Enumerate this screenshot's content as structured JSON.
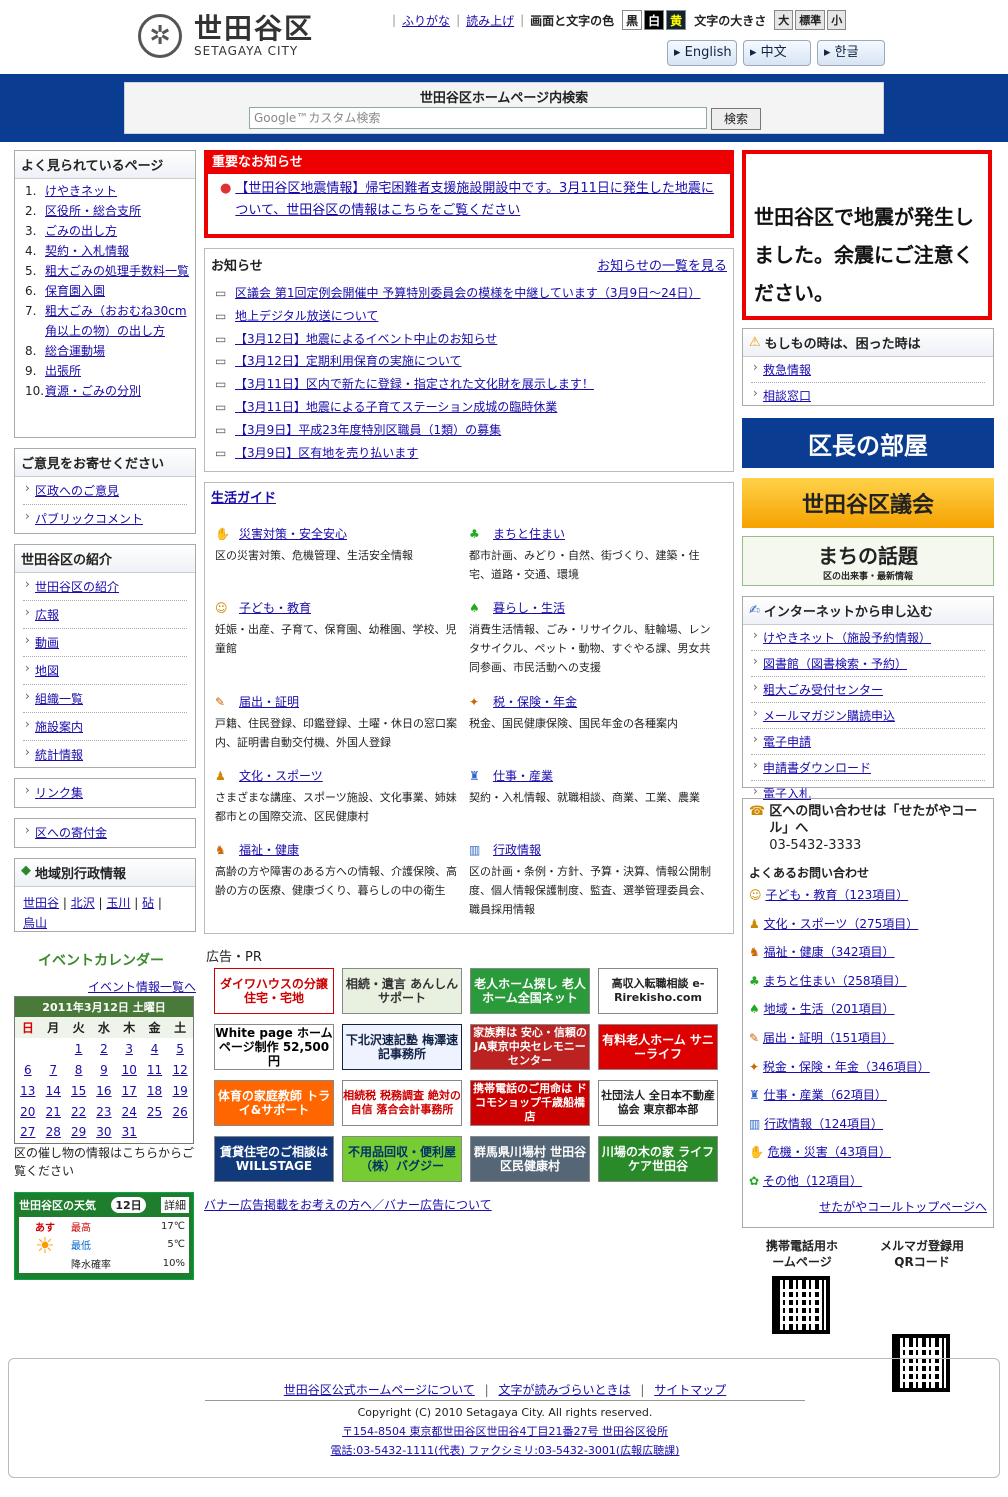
{
  "header": {
    "logo_jp": "世田谷区",
    "logo_en": "SETAGAYA CITY",
    "furigana": "ふりがな",
    "read_aloud": "読み上げ",
    "color_label": "画面と文字の色",
    "colors": [
      "黒",
      "白",
      "黄"
    ],
    "size_label": "文字の大きさ",
    "sizes": [
      "大",
      "標準",
      "小"
    ],
    "langs": [
      "▸ English",
      "▸ 中文",
      "▸ 한글"
    ]
  },
  "search": {
    "title": "世田谷区ホームページ内検索",
    "placeholder": "Google™カスタム検索",
    "button": "検索"
  },
  "popular": {
    "title": "よく見られているページ",
    "items": [
      {
        "n": "1.",
        "t": "けやきネット"
      },
      {
        "n": "2.",
        "t": "区役所・総合支所"
      },
      {
        "n": "3.",
        "t": "ごみの出し方"
      },
      {
        "n": "4.",
        "t": "契約・入札情報"
      },
      {
        "n": "5.",
        "t": "粗大ごみの処理手数料一覧"
      },
      {
        "n": "6.",
        "t": "保育園入園"
      },
      {
        "n": "7.",
        "t": "粗大ごみ（おおむね30cm角以上の物）の出し方"
      },
      {
        "n": "8.",
        "t": "総合運動場"
      },
      {
        "n": "9.",
        "t": "出張所"
      },
      {
        "n": "10.",
        "t": "資源・ごみの分別"
      }
    ]
  },
  "opinion": {
    "title": "ご意見をお寄せください",
    "items": [
      "区政へのご意見",
      "パブリックコメント"
    ]
  },
  "intro": {
    "title": "世田谷区の紹介",
    "items": [
      "世田谷区の紹介",
      "広報",
      "動画",
      "地図",
      "組織一覧",
      "施設案内",
      "統計情報"
    ]
  },
  "links": {
    "a": "リンク集",
    "b": "区への寄付金"
  },
  "regional": {
    "title": "地域別行政情報",
    "items": [
      "世田谷",
      "北沢",
      "玉川",
      "砧",
      "烏山"
    ]
  },
  "event": {
    "title": "イベントカレンダー",
    "list_link": "イベント情報一覧へ",
    "month": "2011年3月12日 土曜日",
    "dows": [
      "日",
      "月",
      "火",
      "水",
      "木",
      "金",
      "土"
    ],
    "weeks": [
      [
        "",
        "",
        "1",
        "2",
        "3",
        "4",
        "5"
      ],
      [
        "6",
        "7",
        "8",
        "9",
        "10",
        "11",
        "12"
      ],
      [
        "13",
        "14",
        "15",
        "16",
        "17",
        "18",
        "19"
      ],
      [
        "20",
        "21",
        "22",
        "23",
        "24",
        "25",
        "26"
      ],
      [
        "27",
        "28",
        "29",
        "30",
        "31",
        "",
        ""
      ]
    ],
    "note": "区の催し物の情報はこちらからご覧ください"
  },
  "weather": {
    "title": "世田谷区の天気",
    "date": "12日",
    "detail": "詳細",
    "day": "あす",
    "rows": [
      [
        "最高",
        "17℃"
      ],
      [
        "最低",
        "5℃"
      ],
      [
        "降水確率",
        "10%"
      ]
    ]
  },
  "alert": {
    "title": "重要なお知らせ",
    "text": "【世田谷区地震情報】帰宅困難者支援施設開設中です。3月11日に発生した地震について、世田谷区の情報はこちらをご覧ください"
  },
  "news": {
    "title": "お知らせ",
    "list_link": "お知らせの一覧を見る",
    "items": [
      "区議会 第1回定例会開催中 予算特別委員会の模様を中継しています（3月9日～24日）",
      "地上デジタル放送について",
      "【3月12日】地震によるイベント中止のお知らせ",
      "【3月12日】定期利用保育の実施について",
      "【3月11日】区内で新たに登録・指定された文化財を展示します！",
      "【3月11日】地震による子育てステーション成城の臨時休業",
      "【3月9日】平成23年度特別区職員（1類）の募集",
      "【3月9日】区有地を売り払います"
    ]
  },
  "guide": {
    "title": "生活ガイド",
    "items": [
      {
        "t": "災害対策・安全安心",
        "d": "区の災害対策、危機管理、生活安全情報"
      },
      {
        "t": "まちと住まい",
        "d": "都市計画、みどり・自然、街づくり、建築・住宅、道路・交通、環境"
      },
      {
        "t": "子ども・教育",
        "d": "妊娠・出産、子育て、保育園、幼稚園、学校、児童館"
      },
      {
        "t": "暮らし・生活",
        "d": "消費生活情報、ごみ・リサイクル、駐輪場、レンタサイクル、ペット・動物、すぐやる課、男女共同参画、市民活動への支援"
      },
      {
        "t": "届出・証明",
        "d": "戸籍、住民登録、印鑑登録、土曜・休日の窓口案内、証明書自動交付機、外国人登録"
      },
      {
        "t": "税・保険・年金",
        "d": "税金、国民健康保険、国民年金の各種案内"
      },
      {
        "t": "文化・スポーツ",
        "d": "さまざまな講座、スポーツ施設、文化事業、姉妹都市との国際交流、区民健康村"
      },
      {
        "t": "仕事・産業",
        "d": "契約・入札情報、就職相談、商業、工業、農業"
      },
      {
        "t": "福祉・健康",
        "d": "高齢の方や障害のある方への情報、介護保険、高齢の方の医療、健康づくり、暮らしの中の衛生"
      },
      {
        "t": "行政情報",
        "d": "区の計画・条例・方針、予算・決算、情報公開制度、個人情報保護制度、監査、選挙管理委員会、職員採用情報"
      }
    ]
  },
  "ads": {
    "title": "広告・PR",
    "items": [
      "ダイワハウスの分譲住宅・宅地",
      "相続・遺言 あんしんサポート",
      "老人ホーム探し 老人ホーム全国ネット",
      "高収入転職相談 e-Rirekisho.com",
      "White page ホームページ制作 52,500円",
      "下北沢速記塾 梅澤速記事務所",
      "家族葬は 安心・信頼の JA東京中央セレモニーセンター",
      "有料老人ホーム サニーライフ",
      "体育の家庭教師 トライ&サポート",
      "相続税 税務調査 絶対の自信 落合会計事務所",
      "携帯電話のご用命は ドコモショップ千歳船橋店",
      "社団法人 全日本不動産協会 東京都本部",
      "賃貸住宅のご相談は WILLSTAGE",
      "不用品回収・便利屋（株）バグジー",
      "群馬県川場村 世田谷区民健康村",
      "川場の木の家 ライフケア世田谷"
    ],
    "footer": "バナー広告掲載をお考えの方へ／バナー広告について"
  },
  "right": {
    "quake": "世田谷区で地震が発生しました。余震にご注意ください。",
    "emergency_title": "もしもの時は、困った時は",
    "emergency": [
      "救急情報",
      "相談窓口"
    ],
    "mayor": "区長の部屋",
    "assembly": "世田谷区議会",
    "topics": "まちの話題",
    "topics_sub": "区の出来事・最新情報",
    "online_title": "インターネットから申し込む",
    "online": [
      "けやきネット（施設予約情報）",
      "図書館（図書検索・予約）",
      "粗大ごみ受付センター",
      "メールマガジン購読申込",
      "電子申請",
      "申請書ダウンロード",
      "電子入札"
    ],
    "call_title": "区への問い合わせは「せたがやコール」へ",
    "call_tel": "03-5432-3333",
    "faq_title": "よくあるお問い合わせ",
    "faq": [
      "子ども・教育（123項目）",
      "文化・スポーツ（275項目）",
      "福祉・健康（342項目）",
      "まちと住まい（258項目）",
      "地域・生活（201項目）",
      "届出・証明（151項目）",
      "税金・保険・年金（346項目）",
      "仕事・産業（62項目）",
      "行政情報（124項目）",
      "危機・災害（43項目）",
      "その他（12項目）"
    ],
    "call_top": "せたがやコールトップページへ",
    "qr1": "携帯電話用ホームページ",
    "qr2": "メルマガ登録用QRコード"
  },
  "footer": {
    "links": [
      "世田谷区公式ホームページについて",
      "文字が読みづらいときは",
      "サイトマップ"
    ],
    "copyright": "Copyright (C) 2010 Setagaya City. All rights reserved.",
    "address": "〒154-8504 東京都世田谷区世田谷4丁目21番27号 世田谷区役所",
    "tel": "電話:03-5432-1111(代表) ファクシミリ:03-5432-3001(広報広聴課)"
  }
}
